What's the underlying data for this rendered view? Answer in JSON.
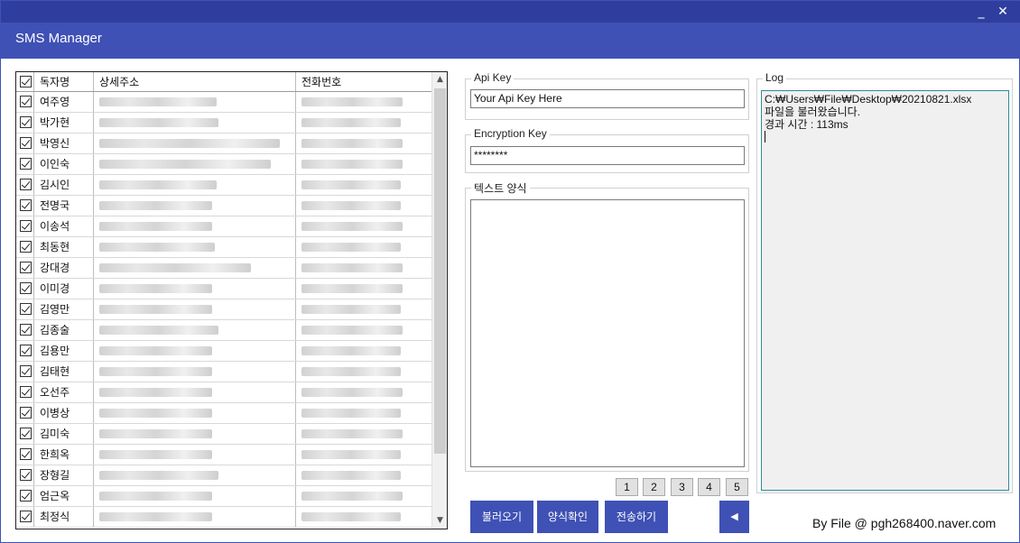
{
  "window": {
    "title": "SMS Manager",
    "minimize": "_",
    "close": "✕"
  },
  "table": {
    "columns": {
      "name": "독자명",
      "address": "상세주소",
      "phone": "전화번호"
    },
    "rows": [
      {
        "name": "여주영",
        "checked": true
      },
      {
        "name": "박가현",
        "checked": true
      },
      {
        "name": "박영신",
        "checked": true
      },
      {
        "name": "이인숙",
        "checked": true
      },
      {
        "name": "김시인",
        "checked": true
      },
      {
        "name": "전명국",
        "checked": true
      },
      {
        "name": "이송석",
        "checked": true
      },
      {
        "name": "최동현",
        "checked": true
      },
      {
        "name": "강대경",
        "checked": true
      },
      {
        "name": "이미경",
        "checked": true
      },
      {
        "name": "김영만",
        "checked": true
      },
      {
        "name": "김종술",
        "checked": true
      },
      {
        "name": "김용만",
        "checked": true
      },
      {
        "name": "김태현",
        "checked": true
      },
      {
        "name": "오선주",
        "checked": true
      },
      {
        "name": "이병상",
        "checked": true
      },
      {
        "name": "김미숙",
        "checked": true
      },
      {
        "name": "한희옥",
        "checked": true
      },
      {
        "name": "장형길",
        "checked": true
      },
      {
        "name": "엄근옥",
        "checked": true
      },
      {
        "name": "최정식",
        "checked": true
      }
    ]
  },
  "api": {
    "label": "Api Key",
    "value": "Your Api Key Here"
  },
  "encryption": {
    "label": "Encryption Key",
    "value": "********"
  },
  "template": {
    "label": "텍스트 양식",
    "value": ""
  },
  "log": {
    "label": "Log",
    "lines": [
      "C:₩Users₩File₩Desktop₩20210821.xlsx",
      "파일을 불러왔습니다.",
      "경과 시간 : 113ms"
    ]
  },
  "pages": [
    "1",
    "2",
    "3",
    "4",
    "5"
  ],
  "buttons": {
    "load": "불러오기",
    "check": "양식확인",
    "send": "전송하기",
    "back": "◀"
  },
  "footer": "By File @ pgh268400.naver.com",
  "colors": {
    "accent": "#3f51b5",
    "topbar": "#2f3e9e"
  }
}
